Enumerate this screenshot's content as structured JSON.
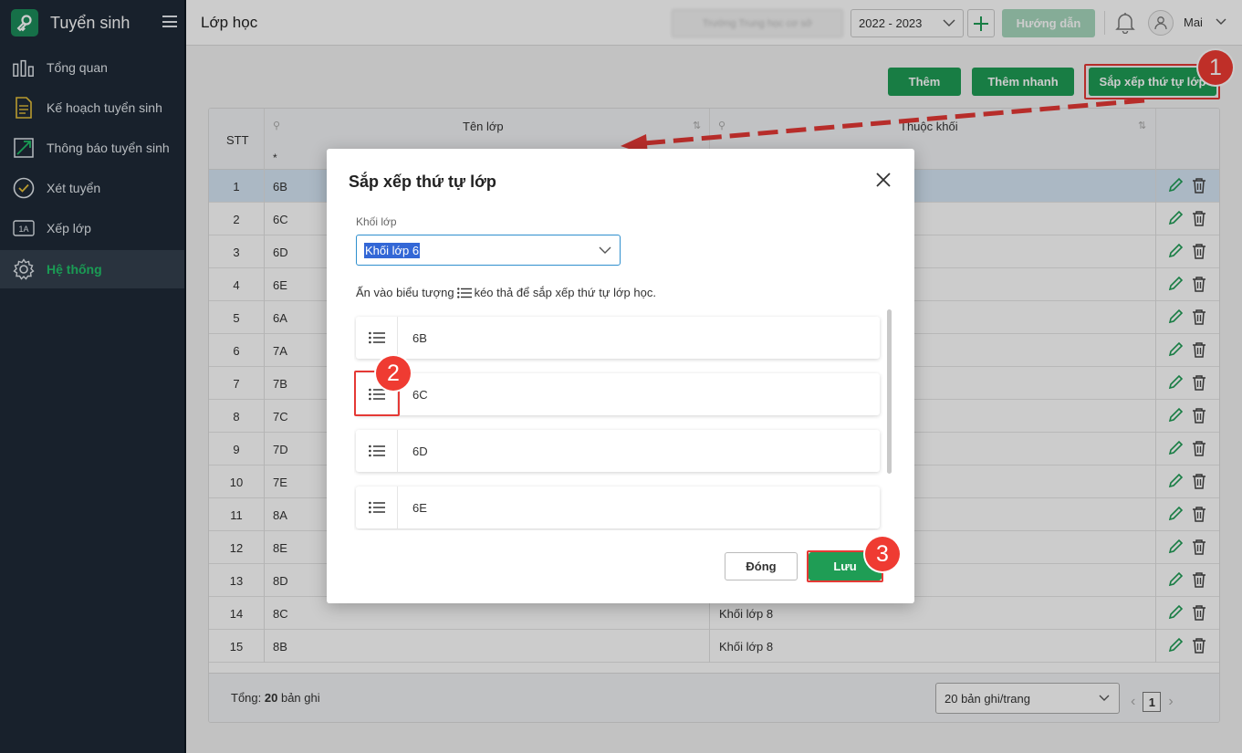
{
  "app": {
    "title": "Tuyển sinh"
  },
  "sidebar": {
    "items": [
      {
        "label": "Tổng quan",
        "icon": "chart-bars-icon"
      },
      {
        "label": "Kế hoạch tuyển sinh",
        "icon": "document-icon"
      },
      {
        "label": "Thông báo tuyển sinh",
        "icon": "trend-arrow-icon"
      },
      {
        "label": "Xét tuyển",
        "icon": "check-circle-icon"
      },
      {
        "label": "Xếp lớp",
        "icon": "class-1a-icon",
        "badge": "1A"
      },
      {
        "label": "Hệ thống",
        "icon": "gear-icon",
        "active": true
      }
    ]
  },
  "header": {
    "page_title": "Lớp học",
    "school_name": "Trường Trung học cơ sở",
    "year": "2022 - 2023",
    "guide_label": "Hướng dẫn",
    "user_name": "Mai"
  },
  "toolbar": {
    "add_label": "Thêm",
    "quick_add_label": "Thêm nhanh",
    "sort_label": "Sắp xếp thứ tự lớp"
  },
  "table": {
    "columns": {
      "stt": "STT",
      "name": "Tên lớp",
      "grade": "Thuộc khối"
    },
    "filter_star": "*",
    "rows": [
      {
        "stt": "1",
        "name": "6B",
        "grade": ""
      },
      {
        "stt": "2",
        "name": "6C",
        "grade": ""
      },
      {
        "stt": "3",
        "name": "6D",
        "grade": ""
      },
      {
        "stt": "4",
        "name": "6E",
        "grade": ""
      },
      {
        "stt": "5",
        "name": "6A",
        "grade": ""
      },
      {
        "stt": "6",
        "name": "7A",
        "grade": ""
      },
      {
        "stt": "7",
        "name": "7B",
        "grade": ""
      },
      {
        "stt": "8",
        "name": "7C",
        "grade": ""
      },
      {
        "stt": "9",
        "name": "7D",
        "grade": ""
      },
      {
        "stt": "10",
        "name": "7E",
        "grade": ""
      },
      {
        "stt": "11",
        "name": "8A",
        "grade": ""
      },
      {
        "stt": "12",
        "name": "8E",
        "grade": ""
      },
      {
        "stt": "13",
        "name": "8D",
        "grade": ""
      },
      {
        "stt": "14",
        "name": "8C",
        "grade": "Khối lớp 8"
      },
      {
        "stt": "15",
        "name": "8B",
        "grade": "Khối lớp 8"
      }
    ],
    "footer": {
      "total_prefix": "Tổng:",
      "total_count": "20",
      "total_suffix": "bản ghi",
      "page_size": "20 bản ghi/trang",
      "page": "1"
    }
  },
  "modal": {
    "title": "Sắp xếp thứ tự lớp",
    "field_label": "Khối lớp",
    "field_value": "Khối lớp 6",
    "hint_before": "Ấn vào biểu tượng",
    "hint_after": "kéo thả để sắp xếp thứ tự lớp học.",
    "items": [
      "6B",
      "6C",
      "6D",
      "6E"
    ],
    "close_label": "Đóng",
    "save_label": "Lưu"
  },
  "callouts": [
    "1",
    "2",
    "3"
  ],
  "colors": {
    "sidebar": "#1e2a38",
    "accent": "#1f9d55",
    "active_text": "#21c26a",
    "callout": "#ef3b32",
    "selected_row": "#d6e6f5"
  }
}
